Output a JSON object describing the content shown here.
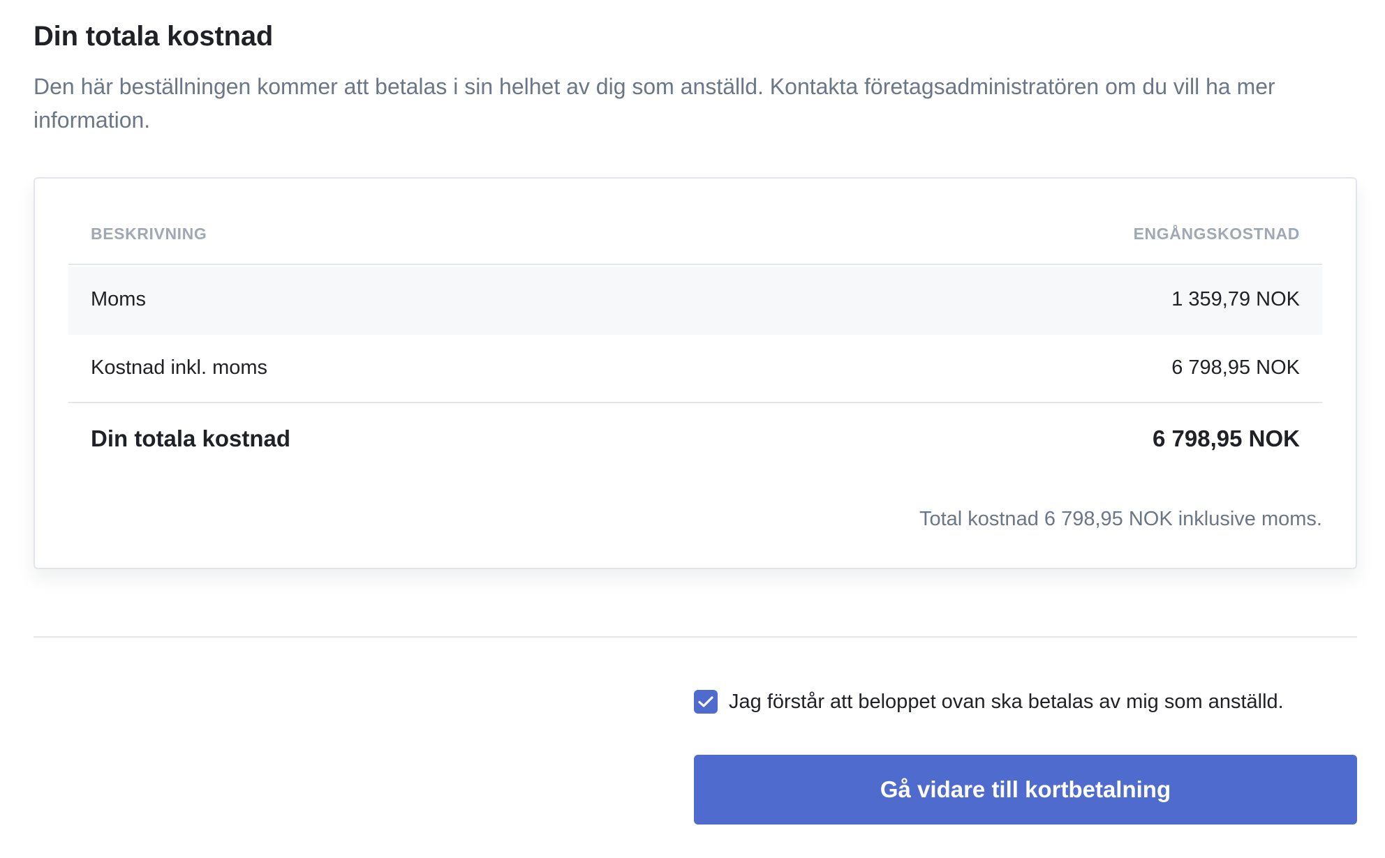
{
  "header": {
    "title": "Din totala kostnad",
    "description": "Den här beställningen kommer att betalas i sin helhet av dig som anställd. Kontakta företagsadministratören om du vill ha mer information."
  },
  "cost_table": {
    "columns": {
      "description": "BESKRIVNING",
      "one_time_cost": "ENGÅNGSKOSTNAD"
    },
    "rows": [
      {
        "label": "Moms",
        "value": "1 359,79 NOK"
      },
      {
        "label": "Kostnad inkl. moms",
        "value": "6 798,95 NOK"
      }
    ],
    "total": {
      "label": "Din totala kostnad",
      "value": "6 798,95 NOK"
    },
    "note": "Total kostnad 6 798,95 NOK inklusive moms."
  },
  "confirmation": {
    "checked": true,
    "label": "Jag förstår att beloppet ovan ska betalas av mig som anställd."
  },
  "actions": {
    "continue_label": "Gå vidare till kortbetalning"
  },
  "colors": {
    "accent": "#4f6bcd",
    "muted_text": "#6b7688",
    "row_highlight": "#f7f8fa"
  }
}
